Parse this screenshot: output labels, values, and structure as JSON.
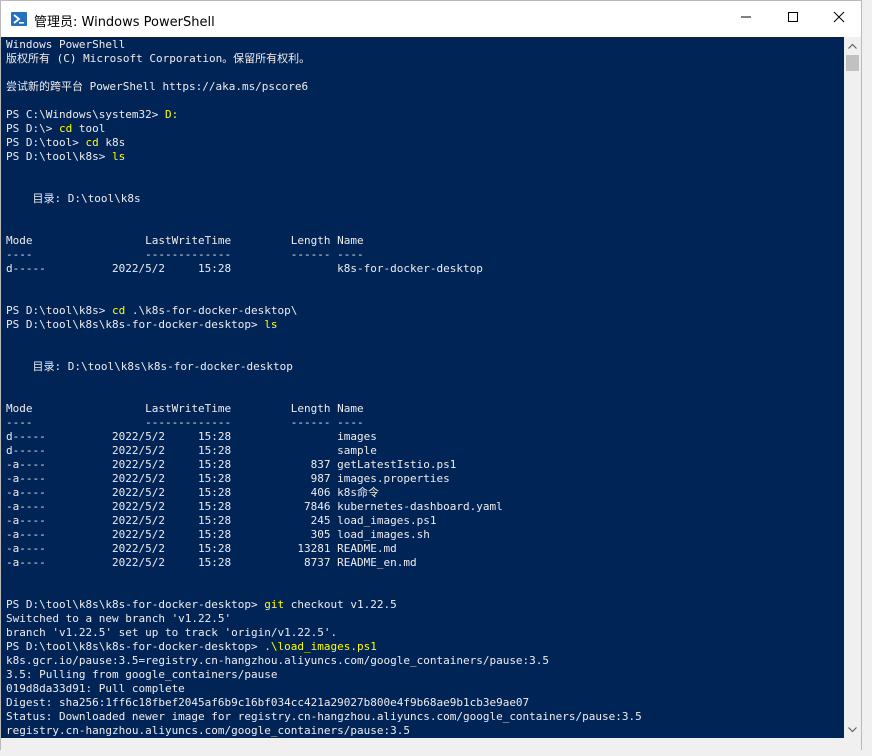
{
  "window": {
    "title": "管理员: Windows PowerShell",
    "minimize_icon": "minimize-icon",
    "maximize_icon": "maximize-icon",
    "close_icon": "close-icon"
  },
  "colors": {
    "console_bg": "#012456",
    "console_text": "#eeedf0",
    "command_highlight": "#ffff00"
  },
  "console": {
    "lines": [
      {
        "text": "Windows PowerShell"
      },
      {
        "text": "版权所有 (C) Microsoft Corporation。保留所有权利。"
      },
      {
        "text": ""
      },
      {
        "text": "尝试新的跨平台 PowerShell https://aka.ms/pscore6"
      },
      {
        "text": ""
      },
      {
        "prompt": "PS C:\\Windows\\system32> ",
        "cmd": "D:"
      },
      {
        "prompt": "PS D:\\> ",
        "cmd": "cd",
        "rest": " tool"
      },
      {
        "prompt": "PS D:\\tool> ",
        "cmd": "cd",
        "rest": " k8s"
      },
      {
        "prompt": "PS D:\\tool\\k8s> ",
        "cmd": "ls"
      },
      {
        "text": ""
      },
      {
        "text": ""
      },
      {
        "text": "    目录: D:\\tool\\k8s"
      },
      {
        "text": ""
      },
      {
        "text": ""
      },
      {
        "text": "Mode                 LastWriteTime         Length Name"
      },
      {
        "text": "----                 -------------         ------ ----"
      },
      {
        "text": "d-----          2022/5/2     15:28                k8s-for-docker-desktop"
      },
      {
        "text": ""
      },
      {
        "text": ""
      },
      {
        "prompt": "PS D:\\tool\\k8s> ",
        "cmd": "cd",
        "rest": " .\\k8s-for-docker-desktop\\"
      },
      {
        "prompt": "PS D:\\tool\\k8s\\k8s-for-docker-desktop> ",
        "cmd": "ls"
      },
      {
        "text": ""
      },
      {
        "text": ""
      },
      {
        "text": "    目录: D:\\tool\\k8s\\k8s-for-docker-desktop"
      },
      {
        "text": ""
      },
      {
        "text": ""
      },
      {
        "text": "Mode                 LastWriteTime         Length Name"
      },
      {
        "text": "----                 -------------         ------ ----"
      },
      {
        "text": "d-----          2022/5/2     15:28                images"
      },
      {
        "text": "d-----          2022/5/2     15:28                sample"
      },
      {
        "text": "-a----          2022/5/2     15:28            837 getLatestIstio.ps1"
      },
      {
        "text": "-a----          2022/5/2     15:28            987 images.properties"
      },
      {
        "text": "-a----          2022/5/2     15:28            406 k8s命令"
      },
      {
        "text": "-a----          2022/5/2     15:28           7846 kubernetes-dashboard.yaml"
      },
      {
        "text": "-a----          2022/5/2     15:28            245 load_images.ps1"
      },
      {
        "text": "-a----          2022/5/2     15:28            305 load_images.sh"
      },
      {
        "text": "-a----          2022/5/2     15:28          13281 README.md"
      },
      {
        "text": "-a----          2022/5/2     15:28           8737 README_en.md"
      },
      {
        "text": ""
      },
      {
        "text": ""
      },
      {
        "prompt": "PS D:\\tool\\k8s\\k8s-for-docker-desktop> ",
        "cmd": "git",
        "rest": " checkout v1.22.5"
      },
      {
        "text": "Switched to a new branch 'v1.22.5'"
      },
      {
        "text": "branch 'v1.22.5' set up to track 'origin/v1.22.5'."
      },
      {
        "prompt": "PS D:\\tool\\k8s\\k8s-for-docker-desktop> ",
        "cmd": ".\\load_images.ps1"
      },
      {
        "text": "k8s.gcr.io/pause:3.5=registry.cn-hangzhou.aliyuncs.com/google_containers/pause:3.5"
      },
      {
        "text": "3.5: Pulling from google_containers/pause"
      },
      {
        "text": "019d8da33d91: Pull complete"
      },
      {
        "text": "Digest: sha256:1ff6c18fbef2045af6b9c16bf034cc421a29027b800e4f9b68ae9b1cb3e9ae07"
      },
      {
        "text": "Status: Downloaded newer image for registry.cn-hangzhou.aliyuncs.com/google_containers/pause:3.5"
      },
      {
        "text": "registry.cn-hangzhou.aliyuncs.com/google_containers/pause:3.5"
      }
    ]
  }
}
